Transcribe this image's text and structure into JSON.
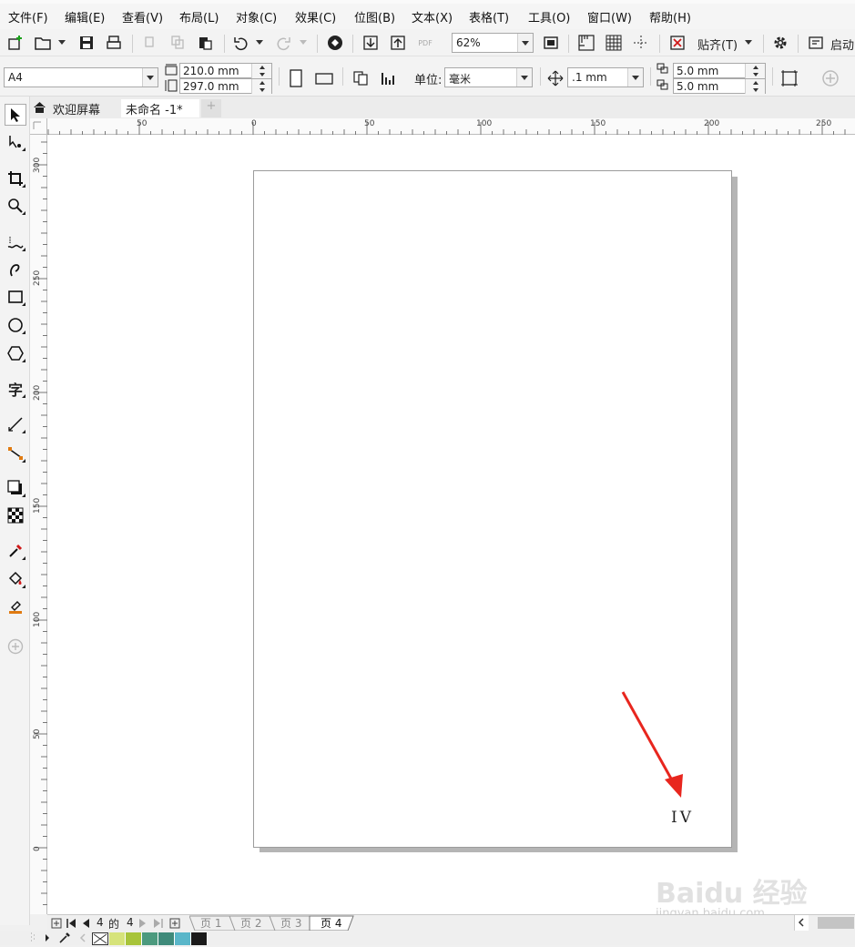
{
  "menu": {
    "items": [
      "文件(F)",
      "编辑(E)",
      "查看(V)",
      "布局(L)",
      "对象(C)",
      "效果(C)",
      "位图(B)",
      "文本(X)",
      "表格(T)",
      "工具(O)",
      "窗口(W)",
      "帮助(H)"
    ]
  },
  "toolbar": {
    "zoom": "62%",
    "snap_label": "贴齐(T)",
    "launch_label": "启动",
    "pdf_label": "PDF"
  },
  "property_bar": {
    "page_size": "A4",
    "width": "210.0 mm",
    "height": "297.0 mm",
    "units_label": "单位:",
    "units_value": "毫米",
    "nudge": ".1 mm",
    "dup_x": "5.0 mm",
    "dup_y": "5.0 mm"
  },
  "doc_tabs": {
    "welcome": "欢迎屏幕",
    "document": "未命名 -1*",
    "add": "+"
  },
  "ruler": {
    "h_labels": [
      "50",
      "0",
      "50",
      "100",
      "150",
      "200",
      "250"
    ],
    "v_labels": [
      "300",
      "250",
      "200",
      "150",
      "100",
      "50",
      "0"
    ]
  },
  "page": {
    "number_text": "IV",
    "annotation_color": "#e8261e"
  },
  "page_nav": {
    "current": "4",
    "of": "的",
    "total": "4",
    "tabs": [
      "页 1",
      "页 2",
      "页 3",
      "页 4"
    ],
    "active_tab": "页 4"
  },
  "palette": {
    "colors": [
      "#d6e37a",
      "#a8c43a",
      "#4c9a7e",
      "#3f8a7a",
      "#5ab6c9",
      "#1a1a1a"
    ]
  },
  "watermark": {
    "main": "Baidu 经验",
    "sub": "jingyan.baidu.com"
  }
}
